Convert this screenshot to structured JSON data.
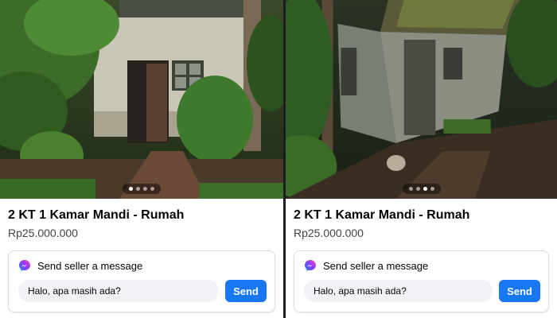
{
  "listings": [
    {
      "title": "2 KT 1 Kamar Mandi - Rumah",
      "price": "Rp25.000.000",
      "photo_count": 4,
      "active_photo": 0,
      "message_prompt": "Send seller a message",
      "message_value": "Halo, apa masih ada?",
      "send_label": "Send",
      "icon": "messenger-icon"
    },
    {
      "title": "2 KT 1 Kamar Mandi - Rumah",
      "price": "Rp25.000.000",
      "photo_count": 4,
      "active_photo": 2,
      "message_prompt": "Send seller a message",
      "message_value": "Halo, apa masih ada?",
      "send_label": "Send",
      "icon": "messenger-icon"
    }
  ],
  "colors": {
    "accent": "#1877f2",
    "background": "#ffffff",
    "input_bg": "#f0f2f5"
  }
}
